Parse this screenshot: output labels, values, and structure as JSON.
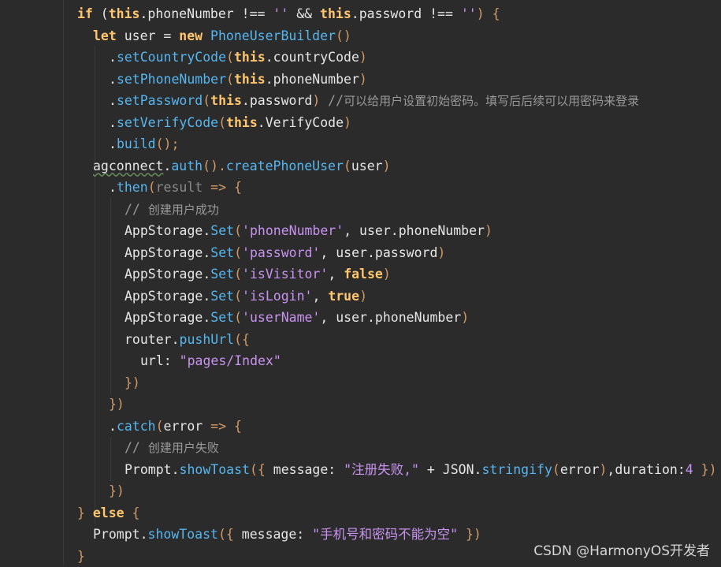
{
  "code_lines": [
    {
      "indent": 0,
      "tokens": [
        {
          "t": "if",
          "c": "kw"
        },
        {
          "t": " (",
          "c": "op"
        },
        {
          "t": "this",
          "c": "kw"
        },
        {
          "t": ".phoneNumber !== ",
          "c": "plain"
        },
        {
          "t": "''",
          "c": "str"
        },
        {
          "t": " && ",
          "c": "op"
        },
        {
          "t": "this",
          "c": "kw"
        },
        {
          "t": ".password !== ",
          "c": "plain"
        },
        {
          "t": "''",
          "c": "str"
        },
        {
          "t": ") {",
          "c": "paren"
        }
      ]
    },
    {
      "indent": 1,
      "tokens": [
        {
          "t": "let",
          "c": "kw"
        },
        {
          "t": " user = ",
          "c": "plain"
        },
        {
          "t": "new",
          "c": "kw"
        },
        {
          "t": " ",
          "c": "plain"
        },
        {
          "t": "PhoneUserBuilder",
          "c": "cls"
        },
        {
          "t": "()",
          "c": "paren"
        }
      ]
    },
    {
      "indent": 2,
      "tokens": [
        {
          "t": ".",
          "c": "plain"
        },
        {
          "t": "setCountryCode",
          "c": "fn"
        },
        {
          "t": "(",
          "c": "paren"
        },
        {
          "t": "this",
          "c": "kw"
        },
        {
          "t": ".countryCode",
          "c": "plain"
        },
        {
          "t": ")",
          "c": "paren"
        }
      ]
    },
    {
      "indent": 2,
      "tokens": [
        {
          "t": ".",
          "c": "plain"
        },
        {
          "t": "setPhoneNumber",
          "c": "fn"
        },
        {
          "t": "(",
          "c": "paren"
        },
        {
          "t": "this",
          "c": "kw"
        },
        {
          "t": ".phoneNumber",
          "c": "plain"
        },
        {
          "t": ")",
          "c": "paren"
        }
      ]
    },
    {
      "indent": 2,
      "tokens": [
        {
          "t": ".",
          "c": "plain"
        },
        {
          "t": "setPassword",
          "c": "fn"
        },
        {
          "t": "(",
          "c": "paren"
        },
        {
          "t": "this",
          "c": "kw"
        },
        {
          "t": ".password",
          "c": "plain"
        },
        {
          "t": ")",
          "c": "paren"
        },
        {
          "t": " //",
          "c": "cmt"
        },
        {
          "t": "可以给用户设置初始密码。填写后后续可以用密码来登录",
          "c": "cmt-cn"
        }
      ]
    },
    {
      "indent": 2,
      "tokens": [
        {
          "t": ".",
          "c": "plain"
        },
        {
          "t": "setVerifyCode",
          "c": "fn"
        },
        {
          "t": "(",
          "c": "paren"
        },
        {
          "t": "this",
          "c": "kw"
        },
        {
          "t": ".VerifyCode",
          "c": "plain"
        },
        {
          "t": ")",
          "c": "paren"
        }
      ]
    },
    {
      "indent": 2,
      "tokens": [
        {
          "t": ".",
          "c": "plain"
        },
        {
          "t": "build",
          "c": "fn"
        },
        {
          "t": "();",
          "c": "paren"
        }
      ]
    },
    {
      "indent": 1,
      "tokens": [
        {
          "t": "agconnect",
          "c": "plain squiggle"
        },
        {
          "t": ".",
          "c": "plain"
        },
        {
          "t": "auth",
          "c": "fn"
        },
        {
          "t": "().",
          "c": "paren"
        },
        {
          "t": "createPhoneUser",
          "c": "fn"
        },
        {
          "t": "(",
          "c": "paren"
        },
        {
          "t": "user",
          "c": "plain"
        },
        {
          "t": ")",
          "c": "paren"
        }
      ]
    },
    {
      "indent": 2,
      "tokens": [
        {
          "t": ".",
          "c": "plain"
        },
        {
          "t": "then",
          "c": "fn"
        },
        {
          "t": "(",
          "c": "paren"
        },
        {
          "t": "result",
          "c": "param"
        },
        {
          "t": " => {",
          "c": "paren"
        }
      ]
    },
    {
      "indent": 3,
      "tokens": [
        {
          "t": "// ",
          "c": "cmt"
        },
        {
          "t": "创建用户成功",
          "c": "cmt-cn"
        }
      ]
    },
    {
      "indent": 3,
      "tokens": [
        {
          "t": "AppStorage.",
          "c": "plain"
        },
        {
          "t": "Set",
          "c": "fn"
        },
        {
          "t": "(",
          "c": "paren"
        },
        {
          "t": "'phoneNumber'",
          "c": "str"
        },
        {
          "t": ", user.phoneNumber",
          "c": "plain"
        },
        {
          "t": ")",
          "c": "paren"
        }
      ]
    },
    {
      "indent": 3,
      "tokens": [
        {
          "t": "AppStorage.",
          "c": "plain"
        },
        {
          "t": "Set",
          "c": "fn"
        },
        {
          "t": "(",
          "c": "paren"
        },
        {
          "t": "'password'",
          "c": "str"
        },
        {
          "t": ", user.password",
          "c": "plain"
        },
        {
          "t": ")",
          "c": "paren"
        }
      ]
    },
    {
      "indent": 3,
      "tokens": [
        {
          "t": "AppStorage.",
          "c": "plain"
        },
        {
          "t": "Set",
          "c": "fn"
        },
        {
          "t": "(",
          "c": "paren"
        },
        {
          "t": "'isVisitor'",
          "c": "str"
        },
        {
          "t": ", ",
          "c": "plain"
        },
        {
          "t": "false",
          "c": "kw"
        },
        {
          "t": ")",
          "c": "paren"
        }
      ]
    },
    {
      "indent": 3,
      "tokens": [
        {
          "t": "AppStorage.",
          "c": "plain"
        },
        {
          "t": "Set",
          "c": "fn"
        },
        {
          "t": "(",
          "c": "paren"
        },
        {
          "t": "'isLogin'",
          "c": "str"
        },
        {
          "t": ", ",
          "c": "plain"
        },
        {
          "t": "true",
          "c": "kw"
        },
        {
          "t": ")",
          "c": "paren"
        }
      ]
    },
    {
      "indent": 3,
      "tokens": [
        {
          "t": "AppStorage.",
          "c": "plain"
        },
        {
          "t": "Set",
          "c": "fn"
        },
        {
          "t": "(",
          "c": "paren"
        },
        {
          "t": "'userName'",
          "c": "str"
        },
        {
          "t": ", user.phoneNumber",
          "c": "plain"
        },
        {
          "t": ")",
          "c": "paren"
        }
      ]
    },
    {
      "indent": 3,
      "tokens": [
        {
          "t": "router.",
          "c": "plain"
        },
        {
          "t": "pushUrl",
          "c": "fn"
        },
        {
          "t": "({",
          "c": "paren"
        }
      ]
    },
    {
      "indent": 4,
      "tokens": [
        {
          "t": "url: ",
          "c": "plain"
        },
        {
          "t": "\"pages/Index\"",
          "c": "str"
        }
      ]
    },
    {
      "indent": 3,
      "tokens": [
        {
          "t": "})",
          "c": "paren"
        }
      ]
    },
    {
      "indent": 2,
      "tokens": [
        {
          "t": "})",
          "c": "paren"
        }
      ]
    },
    {
      "indent": 2,
      "tokens": [
        {
          "t": ".",
          "c": "plain"
        },
        {
          "t": "catch",
          "c": "fn"
        },
        {
          "t": "(",
          "c": "paren"
        },
        {
          "t": "error",
          "c": "plain"
        },
        {
          "t": " => {",
          "c": "paren"
        }
      ]
    },
    {
      "indent": 3,
      "tokens": [
        {
          "t": "// ",
          "c": "cmt"
        },
        {
          "t": "创建用户失败",
          "c": "cmt-cn"
        }
      ]
    },
    {
      "indent": 3,
      "tokens": [
        {
          "t": "Prompt.",
          "c": "plain"
        },
        {
          "t": "showToast",
          "c": "fn"
        },
        {
          "t": "({ ",
          "c": "paren"
        },
        {
          "t": "message: ",
          "c": "plain"
        },
        {
          "t": "\"注册失败,\"",
          "c": "str"
        },
        {
          "t": " + JSON.",
          "c": "plain"
        },
        {
          "t": "stringify",
          "c": "fn"
        },
        {
          "t": "(",
          "c": "paren"
        },
        {
          "t": "error",
          "c": "plain"
        },
        {
          "t": ")",
          "c": "paren"
        },
        {
          "t": ",duration:",
          "c": "plain"
        },
        {
          "t": "4",
          "c": "num"
        },
        {
          "t": " })",
          "c": "paren"
        }
      ]
    },
    {
      "indent": 2,
      "tokens": [
        {
          "t": "})",
          "c": "paren"
        }
      ]
    },
    {
      "indent": 0,
      "tokens": [
        {
          "t": "} ",
          "c": "paren"
        },
        {
          "t": "else",
          "c": "kw"
        },
        {
          "t": " {",
          "c": "paren"
        }
      ]
    },
    {
      "indent": 1,
      "tokens": [
        {
          "t": "Prompt.",
          "c": "plain"
        },
        {
          "t": "showToast",
          "c": "fn"
        },
        {
          "t": "({ ",
          "c": "paren"
        },
        {
          "t": "message: ",
          "c": "plain"
        },
        {
          "t": "\"手机号和密码不能为空\"",
          "c": "str"
        },
        {
          "t": " })",
          "c": "paren"
        }
      ]
    },
    {
      "indent": 0,
      "tokens": [
        {
          "t": "}",
          "c": "paren"
        }
      ]
    }
  ],
  "watermark": "CSDN @HarmonyOS开发者"
}
